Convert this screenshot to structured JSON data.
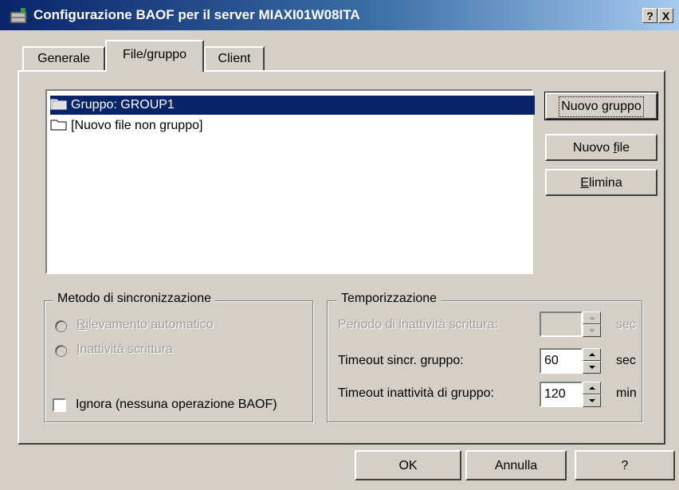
{
  "window": {
    "title": "Configurazione BAOF per il server MIAXI01W08ITA",
    "help_button": "?",
    "close_button": "X"
  },
  "tabs": [
    {
      "label": "Generale",
      "active": false
    },
    {
      "label": "File/gruppo",
      "active": true
    },
    {
      "label": "Client",
      "active": false
    }
  ],
  "list": {
    "items": [
      {
        "label": "Gruppo: GROUP1",
        "icon": "group-folder-icon",
        "selected": true
      },
      {
        "label": "[Nuovo file non gruppo]",
        "icon": "folder-icon",
        "selected": false
      }
    ]
  },
  "side_buttons": {
    "new_group": {
      "pre": "Nuovo ",
      "mnemonic": "g",
      "post": "ruppo"
    },
    "new_file": {
      "pre": "Nuovo ",
      "mnemonic": "f",
      "post": "ile"
    },
    "delete": {
      "pre": "",
      "mnemonic": "E",
      "post": "limina"
    }
  },
  "sync_method": {
    "legend": "Metodo di sincronizzazione",
    "radio_auto": {
      "mnemonic": "R",
      "post": "ilevamento automatico"
    },
    "radio_write": {
      "mnemonic": "I",
      "post": "nattività scrittura"
    },
    "ignore_checkbox": "Ignora (nessuna operazione BAOF)"
  },
  "timing": {
    "legend": "Temporizzazione",
    "write_idle": {
      "label": "Periodo di inattività scrittura:",
      "value": "",
      "unit": "sec"
    },
    "group_sync": {
      "label": "Timeout sincr. gruppo:",
      "value": "60",
      "unit": "sec"
    },
    "group_idle": {
      "label": "Timeout inattività di gruppo:",
      "value": "120",
      "unit": "min"
    }
  },
  "footer": {
    "ok": "OK",
    "cancel": "Annulla",
    "help": "?"
  },
  "colors": {
    "title_start": "#0a246a",
    "selection": "#0a246a",
    "face": "#d4d0c8"
  }
}
